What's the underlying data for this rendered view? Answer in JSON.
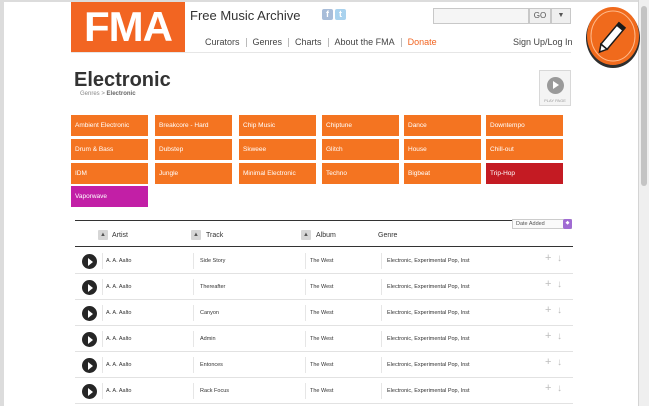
{
  "header": {
    "logo_text": "FMA",
    "site_title": "Free Music Archive",
    "search": {
      "placeholder": "",
      "go_label": "GO",
      "dropdown_icon": "chevron-down-icon"
    },
    "nav": [
      {
        "label": "Curators"
      },
      {
        "label": "Genres"
      },
      {
        "label": "Charts"
      },
      {
        "label": "About the FMA"
      },
      {
        "label": "Donate"
      }
    ],
    "sign_in_label": "Sign Up/Log In"
  },
  "page": {
    "title": "Electronic",
    "breadcrumb": {
      "parent": "Genres",
      "separator": ">",
      "current": "Electronic"
    },
    "play_all_label": "PLAY PAGE"
  },
  "genres": [
    {
      "label": "Ambient Electronic"
    },
    {
      "label": "Breakcore - Hard"
    },
    {
      "label": "Chip Music"
    },
    {
      "label": "Chiptune"
    },
    {
      "label": "Dance"
    },
    {
      "label": "Downtempo"
    },
    {
      "label": "Drum & Bass"
    },
    {
      "label": "Dubstep"
    },
    {
      "label": "Skweee"
    },
    {
      "label": "Glitch"
    },
    {
      "label": "House"
    },
    {
      "label": "Chill-out"
    },
    {
      "label": "IDM"
    },
    {
      "label": "Jungle"
    },
    {
      "label": "Minimal Electronic"
    },
    {
      "label": "Techno"
    },
    {
      "label": "Bigbeat"
    },
    {
      "label": "Trip-Hop",
      "active": true
    },
    {
      "label": "Vaporwave"
    }
  ],
  "sort": {
    "selected": "Date Added"
  },
  "table": {
    "columns": [
      "Artist",
      "Track",
      "Album",
      "Genre"
    ],
    "rows": [
      {
        "artist": "A. A. Aalto",
        "track": "Side Story",
        "album": "The West",
        "genre": "Electronic, Experimental Pop, Inst"
      },
      {
        "artist": "A. A. Aalto",
        "track": "Thereafter",
        "album": "The West",
        "genre": "Electronic, Experimental Pop, Inst"
      },
      {
        "artist": "A. A. Aalto",
        "track": "Canyon",
        "album": "The West",
        "genre": "Electronic, Experimental Pop, Inst"
      },
      {
        "artist": "A. A. Aalto",
        "track": "Admin",
        "album": "The West",
        "genre": "Electronic, Experimental Pop, Inst"
      },
      {
        "artist": "A. A. Aalto",
        "track": "Entonces",
        "album": "The West",
        "genre": "Electronic, Experimental Pop, Inst"
      },
      {
        "artist": "A. A. Aalto",
        "track": "Rack Focus",
        "album": "The West",
        "genre": "Electronic, Experimental Pop, Inst"
      }
    ]
  },
  "colors": {
    "brand": "#f26522",
    "genre_button": "#f47421",
    "genre_active": "#c41b23",
    "genre_vaporwave": "#c21fa6"
  },
  "icons": {
    "play_all": "play-icon",
    "row_play": "play-icon",
    "row_add": "plus-icon",
    "row_download": "download-arrow-icon",
    "editor_badge": "pencil-icon"
  }
}
